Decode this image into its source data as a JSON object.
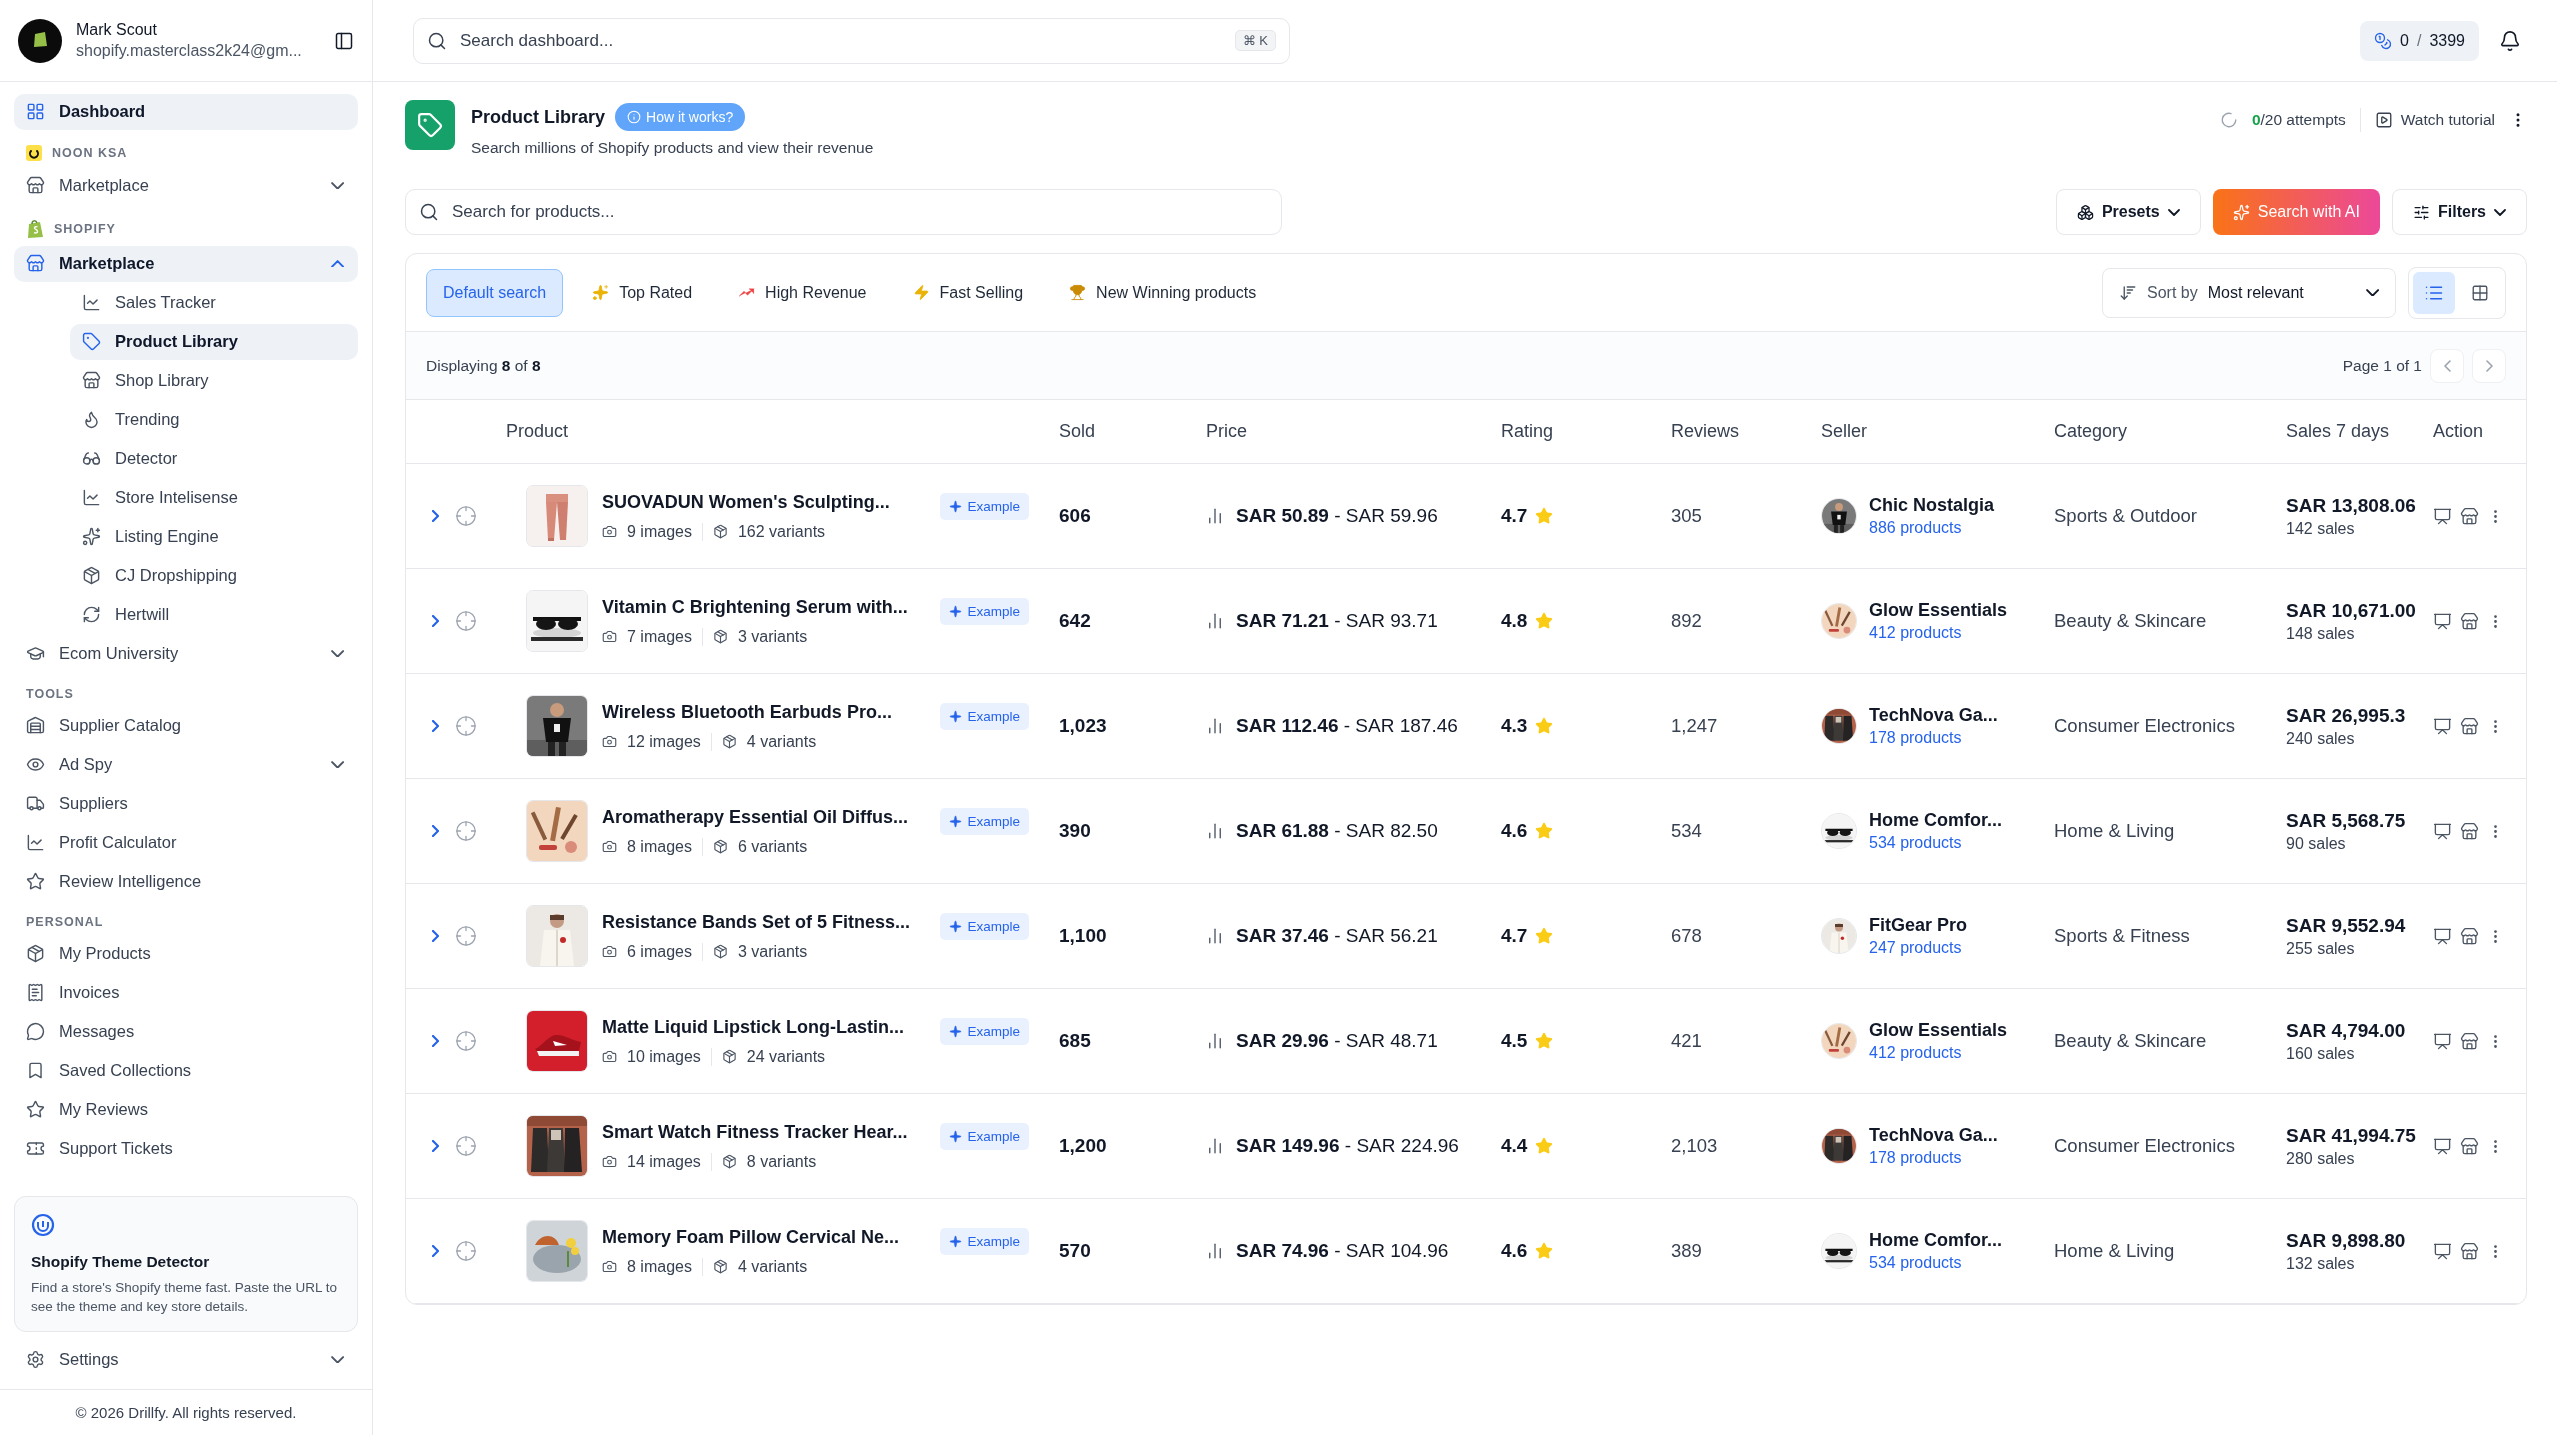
{
  "sidebar": {
    "user": {
      "name": "Mark Scout",
      "email": "shopify.masterclass2k24@gm..."
    },
    "sections": [
      {
        "items": [
          {
            "label": "Dashboard",
            "selected": true
          }
        ]
      },
      {
        "title": "NOON KSA",
        "items": [
          {
            "label": "Marketplace",
            "selected": false,
            "expanded": false
          }
        ]
      },
      {
        "title": "SHOPIFY",
        "items": [
          {
            "label": "Marketplace",
            "selected": true,
            "expanded": true,
            "children": [
              {
                "label": "Sales Tracker",
                "selected": false
              },
              {
                "label": "Product Library",
                "selected": true
              },
              {
                "label": "Shop Library",
                "selected": false
              },
              {
                "label": "Trending",
                "selected": false
              },
              {
                "label": "Detector",
                "selected": false
              },
              {
                "label": "Store Intelisense",
                "selected": false
              },
              {
                "label": "Listing Engine",
                "selected": false
              },
              {
                "label": "CJ Dropshipping",
                "selected": false
              },
              {
                "label": "Hertwill",
                "selected": false
              }
            ]
          },
          {
            "label": "Ecom University",
            "selected": false,
            "expanded": false
          }
        ]
      },
      {
        "title": "TOOLS",
        "items": [
          {
            "label": "Supplier Catalog",
            "selected": false
          },
          {
            "label": "Ad Spy",
            "selected": false,
            "expanded": false
          },
          {
            "label": "Suppliers",
            "selected": false
          },
          {
            "label": "Profit Calculator",
            "selected": false
          },
          {
            "label": "Review Intelligence",
            "selected": false
          }
        ]
      },
      {
        "title": "PERSONAL",
        "items": [
          {
            "label": "My Products",
            "selected": false
          },
          {
            "label": "Invoices",
            "selected": false
          },
          {
            "label": "Messages",
            "selected": false
          },
          {
            "label": "Saved Collections",
            "selected": false
          },
          {
            "label": "My Reviews",
            "selected": false
          },
          {
            "label": "Support Tickets",
            "selected": false
          }
        ]
      }
    ],
    "promo": {
      "title": "Shopify Theme Detector",
      "text": "Find a store's Shopify theme fast. Paste the URL to see the theme and key store details."
    },
    "settings": {
      "label": "Settings",
      "expanded": false
    },
    "footer": "© 2026 Drillfy. All rights reserved."
  },
  "topbar": {
    "search": {
      "placeholder": "Search dashboard..."
    },
    "shortcut": "⌘ K",
    "credits": {
      "used": "0",
      "separator": "/",
      "total": "3399"
    }
  },
  "page": {
    "title": "Product Library",
    "help": "How it works?",
    "subtitle": "Search millions of Shopify products and view their revenue",
    "attempts_used": "0",
    "attempts_rest": "/20 attempts",
    "tutorial": "Watch tutorial"
  },
  "search": {
    "placeholder": "Search for products...",
    "presets": "Presets",
    "ai": "Search with AI",
    "filters": "Filters"
  },
  "tabs": [
    {
      "label": "Default search",
      "selected": true
    },
    {
      "label": "Top Rated",
      "selected": false
    },
    {
      "label": "High Revenue",
      "selected": false
    },
    {
      "label": "Fast Selling",
      "selected": false
    },
    {
      "label": "New Winning products",
      "selected": false
    }
  ],
  "sort": {
    "label": "Sort by",
    "value": "Most relevant"
  },
  "views": [
    {
      "kind": "list",
      "selected": true
    },
    {
      "kind": "grid",
      "selected": false
    }
  ],
  "summary": "Displaying **8** of **8**",
  "pagination": "Page 1 of 1",
  "table": {
    "columns": [
      "Product",
      "Sold",
      "Price",
      "Rating",
      "Reviews",
      "Seller",
      "Category",
      "Sales 7 days",
      "Action"
    ],
    "rows": [
      {
        "expanded": false,
        "title": "SUOVADUN Women's Sculpting...",
        "images": "9 images",
        "variants": "162 variants",
        "badge": "Example",
        "sold": "606",
        "price": "**SAR 50.89** - SAR 59.96",
        "rating": "4.7",
        "reviews": "305",
        "seller": "Chic Nostalgia",
        "seller_products": "886 products",
        "category": "Sports & Outdoor",
        "sales": "SAR 13,808.06",
        "sales_count": "142 sales"
      },
      {
        "expanded": false,
        "title": "Vitamin C Brightening Serum with...",
        "images": "7 images",
        "variants": "3 variants",
        "badge": "Example",
        "sold": "642",
        "price": "**SAR 71.21** - SAR 93.71",
        "rating": "4.8",
        "reviews": "892",
        "seller": "Glow Essentials",
        "seller_products": "412 products",
        "category": "Beauty & Skincare",
        "sales": "SAR 10,671.00",
        "sales_count": "148 sales"
      },
      {
        "expanded": false,
        "title": "Wireless Bluetooth Earbuds Pro...",
        "images": "12 images",
        "variants": "4 variants",
        "badge": "Example",
        "sold": "1,023",
        "price": "**SAR 112.46** - SAR 187.46",
        "rating": "4.3",
        "reviews": "1,247",
        "seller": "TechNova Ga...",
        "seller_products": "178 products",
        "category": "Consumer Electronics",
        "sales": "SAR 26,995.3",
        "sales_count": "240 sales"
      },
      {
        "expanded": false,
        "title": "Aromatherapy Essential Oil Diffus...",
        "images": "8 images",
        "variants": "6 variants",
        "badge": "Example",
        "sold": "390",
        "price": "**SAR 61.88** - SAR 82.50",
        "rating": "4.6",
        "reviews": "534",
        "seller": "Home Comfor...",
        "seller_products": "534 products",
        "category": "Home & Living",
        "sales": "SAR 5,568.75",
        "sales_count": "90 sales"
      },
      {
        "expanded": false,
        "title": "Resistance Bands Set of 5 Fitness...",
        "images": "6 images",
        "variants": "3 variants",
        "badge": "Example",
        "sold": "1,100",
        "price": "**SAR 37.46** - SAR 56.21",
        "rating": "4.7",
        "reviews": "678",
        "seller": "FitGear Pro",
        "seller_products": "247 products",
        "category": "Sports & Fitness",
        "sales": "SAR 9,552.94",
        "sales_count": "255 sales"
      },
      {
        "expanded": false,
        "title": "Matte Liquid Lipstick Long-Lastin...",
        "images": "10 images",
        "variants": "24 variants",
        "badge": "Example",
        "sold": "685",
        "price": "**SAR 29.96** - SAR 48.71",
        "rating": "4.5",
        "reviews": "421",
        "seller": "Glow Essentials",
        "seller_products": "412 products",
        "category": "Beauty & Skincare",
        "sales": "SAR 4,794.00",
        "sales_count": "160 sales"
      },
      {
        "expanded": false,
        "title": "Smart Watch Fitness Tracker Hear...",
        "images": "14 images",
        "variants": "8 variants",
        "badge": "Example",
        "sold": "1,200",
        "price": "**SAR 149.96** - SAR 224.96",
        "rating": "4.4",
        "reviews": "2,103",
        "seller": "TechNova Ga...",
        "seller_products": "178 products",
        "category": "Consumer Electronics",
        "sales": "SAR 41,994.75",
        "sales_count": "280 sales"
      },
      {
        "expanded": false,
        "title": "Memory Foam Pillow Cervical Ne...",
        "images": "8 images",
        "variants": "4 variants",
        "badge": "Example",
        "sold": "570",
        "price": "**SAR 74.96** - SAR 104.96",
        "rating": "4.6",
        "reviews": "389",
        "seller": "Home Comfor...",
        "seller_products": "534 products",
        "category": "Home & Living",
        "sales": "SAR 9,898.80",
        "sales_count": "132 sales"
      }
    ]
  }
}
